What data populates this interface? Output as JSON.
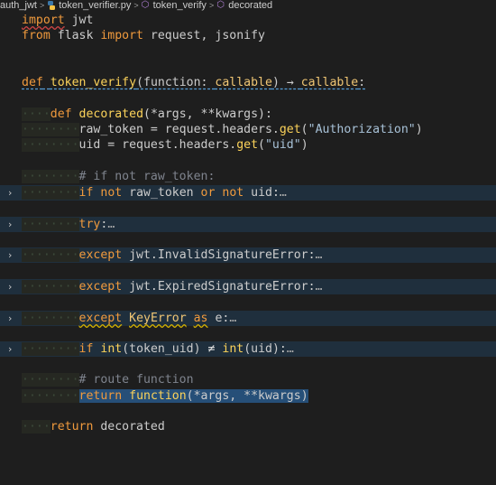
{
  "breadcrumb": {
    "folder": "auth_jwt",
    "file": "token_verifier.py",
    "func": "token_verify",
    "symbol": "decorated"
  },
  "code": {
    "l1": {
      "a": "import",
      "b": " jwt"
    },
    "l2": {
      "a": "from",
      "b": " flask ",
      "c": "import",
      "d": " request, jsonify"
    },
    "l5": {
      "a": "def",
      "b": " ",
      "c": "token_verify",
      "d": "(function: ",
      "e": "callable",
      "f": ") → ",
      "g": "callable",
      "h": ":"
    },
    "l7": {
      "ind": "····",
      "a": "def",
      "b": " ",
      "c": "decorated",
      "d": "(*args, **kwargs):"
    },
    "l8": {
      "ind": "········",
      "a": "raw_token = request.headers.",
      "b": "get",
      "c": "(",
      "d": "\"Authorization\"",
      "e": ")"
    },
    "l9": {
      "ind": "········",
      "a": "uid = request.headers.",
      "b": "get",
      "c": "(",
      "d": "\"uid\"",
      "e": ")"
    },
    "l11": {
      "ind": "········",
      "a": "# if not raw_token:"
    },
    "l12": {
      "ind": "········",
      "a": "if",
      "b": " ",
      "c": "not",
      "d": " raw_token ",
      "e": "or",
      "f": " ",
      "g": "not",
      "h": " uid:",
      "i": "…"
    },
    "l14": {
      "ind": "········",
      "a": "try",
      "b": ":",
      "c": "…"
    },
    "l16": {
      "ind": "········",
      "a": "except",
      "b": " jwt.InvalidSignatureError:",
      "c": "…"
    },
    "l18": {
      "ind": "········",
      "a": "except",
      "b": " jwt.ExpiredSignatureError:",
      "c": "…"
    },
    "l20": {
      "ind": "········",
      "a": "except",
      "b": " ",
      "c": "KeyError",
      "d": " ",
      "e": "as",
      "f": " e:",
      "g": "…"
    },
    "l22": {
      "ind": "········",
      "a": "if",
      "b": " ",
      "c": "int",
      "d": "(token_uid) ",
      "e": "≠",
      "f": " ",
      "g": "int",
      "h": "(uid):",
      "i": "…"
    },
    "l24": {
      "ind": "········",
      "a": "# route function"
    },
    "l25": {
      "ind": "········",
      "a": "return",
      "b": " ",
      "c": "function",
      "d": "(*args, **kwargs)"
    },
    "l27": {
      "ind": "····",
      "a": "return",
      "b": " decorated"
    }
  },
  "fold_glyph": "›",
  "icons": [
    "python-file-icon",
    "cube-icon",
    "chevron-right-icon",
    "lightbulb-icon"
  ]
}
